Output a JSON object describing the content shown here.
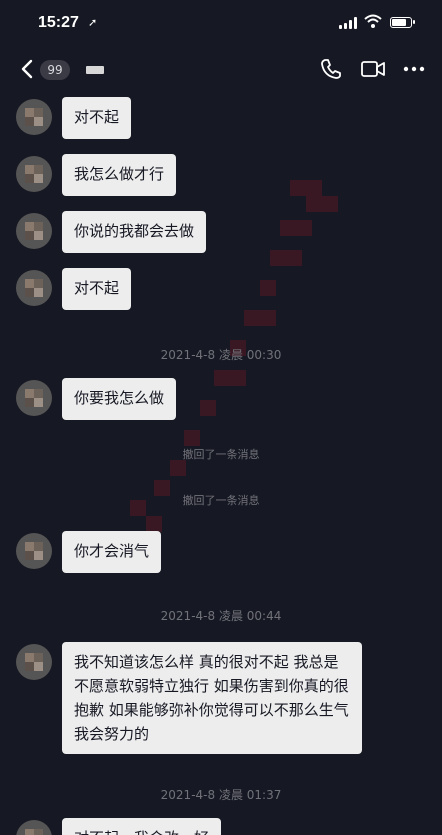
{
  "status_bar": {
    "time": "15:27",
    "location_glyph": "➚",
    "battery_level": 0.85
  },
  "header": {
    "unread_badge": "99"
  },
  "messages": [
    "对不起",
    "我怎么做才行",
    "你说的我都会去做",
    "对不起",
    "你要我怎么做",
    "你才会消气",
    "我不知道该怎么样 真的很对不起 我总是不愿意软弱特立独行 如果伤害到你真的很抱歉 如果能够弥补你觉得可以不那么生气 我会努力的",
    "对不起，我会改，好"
  ],
  "timestamps": [
    "2021-4-8 凌晨 00:30",
    "2021-4-8 凌晨 00:44",
    "2021-4-8 凌晨 01:37"
  ],
  "recall_notices": [
    "撤回了一条消息",
    "撤回了一条消息"
  ],
  "icons": [
    "chevron-left-icon",
    "phone-icon",
    "video-camera-icon",
    "more-icon"
  ],
  "colors": {
    "background": "#161823",
    "bubble": "#ededed",
    "muted_text": "#717279"
  }
}
